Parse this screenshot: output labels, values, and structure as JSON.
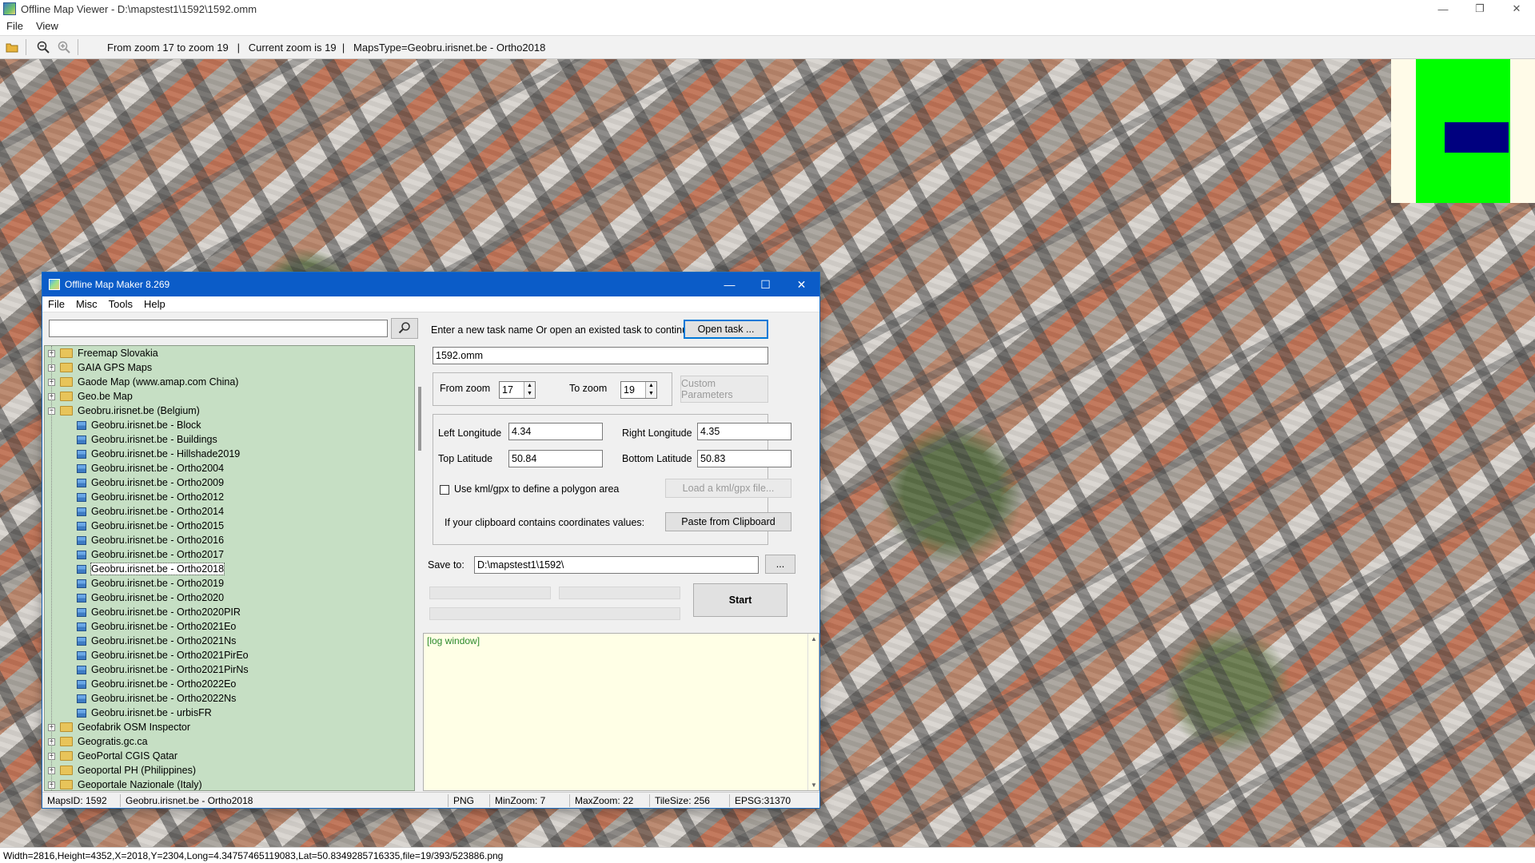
{
  "viewer": {
    "title": "Offline Map Viewer - D:\\mapstest1\\1592\\1592.omm",
    "window_controls": [
      "—",
      "❐",
      "✕"
    ],
    "menu": [
      "File",
      "View"
    ],
    "zoom_info": "From zoom 17 to zoom 19   |   Current zoom is 19  |   MapsType=Geobru.irisnet.be - Ortho2018",
    "status": "Width=2816,Height=4352,X=2018,Y=2304,Long=4.34757465119083,Lat=50.8349285716335,file=19/393/523886.png"
  },
  "minimap_colors": {
    "background": "#fffbe8",
    "area": "#00ff00",
    "viewport": "#00007f"
  },
  "dialog": {
    "title": "Offline Map Maker 8.269",
    "window_controls": [
      "—",
      "☐",
      "✕"
    ],
    "menu": [
      "File",
      "Misc",
      "Tools",
      "Help"
    ],
    "search": {
      "value": "",
      "placeholder": ""
    },
    "tree": {
      "groups_before": [
        "Freemap Slovakia",
        "GAIA GPS Maps",
        "Gaode Map (www.amap.com China)",
        "Geo.be Map"
      ],
      "expanded_group": "Geobru.irisnet.be (Belgium)",
      "children": [
        "Geobru.irisnet.be - Block",
        "Geobru.irisnet.be - Buildings",
        "Geobru.irisnet.be - Hillshade2019",
        "Geobru.irisnet.be - Ortho2004",
        "Geobru.irisnet.be - Ortho2009",
        "Geobru.irisnet.be - Ortho2012",
        "Geobru.irisnet.be - Ortho2014",
        "Geobru.irisnet.be - Ortho2015",
        "Geobru.irisnet.be - Ortho2016",
        "Geobru.irisnet.be - Ortho2017",
        "Geobru.irisnet.be - Ortho2018",
        "Geobru.irisnet.be - Ortho2019",
        "Geobru.irisnet.be - Ortho2020",
        "Geobru.irisnet.be - Ortho2020PIR",
        "Geobru.irisnet.be - Ortho2021Eo",
        "Geobru.irisnet.be - Ortho2021Ns",
        "Geobru.irisnet.be - Ortho2021PirEo",
        "Geobru.irisnet.be - Ortho2021PirNs",
        "Geobru.irisnet.be - Ortho2022Eo",
        "Geobru.irisnet.be - Ortho2022Ns",
        "Geobru.irisnet.be - urbisFR"
      ],
      "selected_child": "Geobru.irisnet.be - Ortho2018",
      "groups_after": [
        "Geofabrik OSM Inspector",
        "Geogratis.gc.ca",
        "GeoPortal CGIS Qatar",
        "Geoportal PH (Philippines)",
        "Geoportale Nazionale (Italy)"
      ],
      "colors": {
        "background": "#c6dfc4"
      }
    },
    "task": {
      "prompt": "Enter a new task name Or open an existed task to continue:",
      "open_button": "Open task ...",
      "name_value": "1592.omm"
    },
    "zoom": {
      "from_label": "From zoom",
      "from_value": "17",
      "to_label": "To zoom",
      "to_value": "19",
      "custom_button": "Custom Parameters"
    },
    "coords": {
      "left_lon_label": "Left Longitude",
      "left_lon_value": "4.34",
      "right_lon_label": "Right Longitude",
      "right_lon_value": "4.35",
      "top_lat_label": "Top Latitude",
      "top_lat_value": "50.84",
      "bottom_lat_label": "Bottom Latitude",
      "bottom_lat_value": "50.83"
    },
    "kml": {
      "checkbox_label": "Use kml/gpx to define a polygon area",
      "checked": false,
      "load_button": "Load a kml/gpx file..."
    },
    "clipboard": {
      "label": "If your clipboard contains coordinates values:",
      "button": "Paste from Clipboard"
    },
    "save": {
      "label": "Save to:",
      "value": "D:\\mapstest1\\1592\\",
      "browse_button": "..."
    },
    "start_button": "Start",
    "log": {
      "text": "[log window]",
      "color": "#2c8a2c",
      "background": "#ffffe6"
    },
    "status": {
      "maps_id": "MapsID: 1592",
      "map_name": "Geobru.irisnet.be - Ortho2018",
      "format": "PNG",
      "min_zoom": "MinZoom: 7",
      "max_zoom": "MaxZoom: 22",
      "tile_size": "TileSize: 256",
      "epsg": "EPSG:31370"
    }
  }
}
